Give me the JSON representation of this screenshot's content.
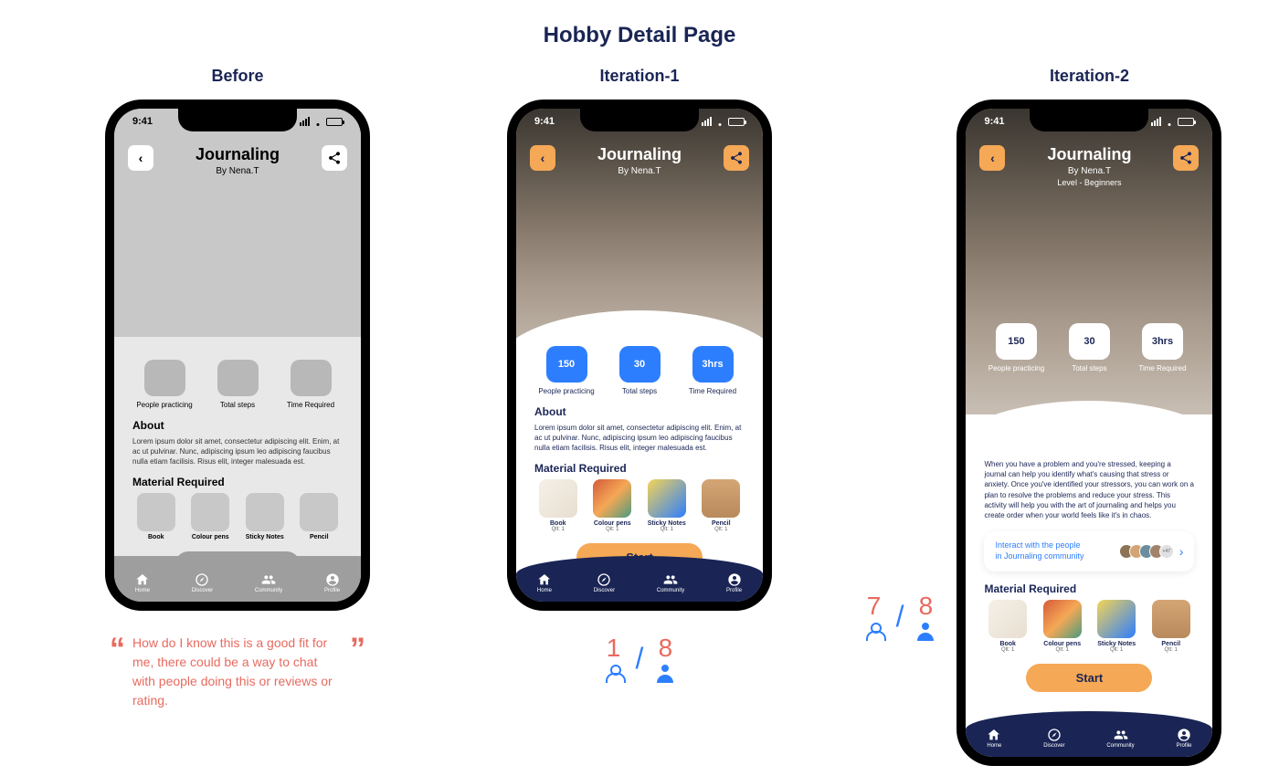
{
  "page_title": "Hobby Detail Page",
  "columns": {
    "before": {
      "label": "Before"
    },
    "iter1": {
      "label": "Iteration-1"
    },
    "iter2": {
      "label": "Iteration-2"
    }
  },
  "status_time": "9:41",
  "hobby": {
    "title": "Journaling",
    "byline": "By  Nena.T",
    "level": "Level - Beginners"
  },
  "stats": [
    {
      "value": "150",
      "label": "People practicing"
    },
    {
      "value": "30",
      "label": "Total steps"
    },
    {
      "value": "3hrs",
      "label": "Time Required"
    }
  ],
  "about_heading": "About",
  "about_lorem": "Lorem ipsum dolor sit amet, consectetur adipiscing elit. Enim, at ac ut pulvinar. Nunc, adipiscing ipsum leo adipiscing faucibus nulla etiam facilisis. Risus elit, integer malesuada est.",
  "about_real": "When you have a problem and you're stressed, keeping a journal can help you identify what's causing that stress or anxiety. Once you've identified your stressors, you can work on a plan to resolve the problems and reduce your stress.  This activity will help you with the art of journaling  and helps you create order when your world feels like it's in chaos.",
  "materials_heading": "Material Required",
  "materials": [
    {
      "name": "Book",
      "qty": "Qlt: 1"
    },
    {
      "name": "Colour pens",
      "qty": "Qlt: 1"
    },
    {
      "name": "Sticky Notes",
      "qty": "Qlt: 1"
    },
    {
      "name": "Pencil",
      "qty": "Qlt: 1"
    }
  ],
  "community_card": {
    "line1": "Interact with the people",
    "line2": "in Journaling community",
    "more": "+47"
  },
  "start_label": "Start",
  "nav": [
    {
      "label": "Home"
    },
    {
      "label": "Discover"
    },
    {
      "label": "Community"
    },
    {
      "label": "Profile"
    }
  ],
  "quote": "How do I know this is a good fit for me, there could be a way to chat with people doing this or reviews or rating.",
  "scores": {
    "iter1": {
      "left": "1",
      "right": "8"
    },
    "iter2": {
      "left": "7",
      "right": "8"
    }
  }
}
